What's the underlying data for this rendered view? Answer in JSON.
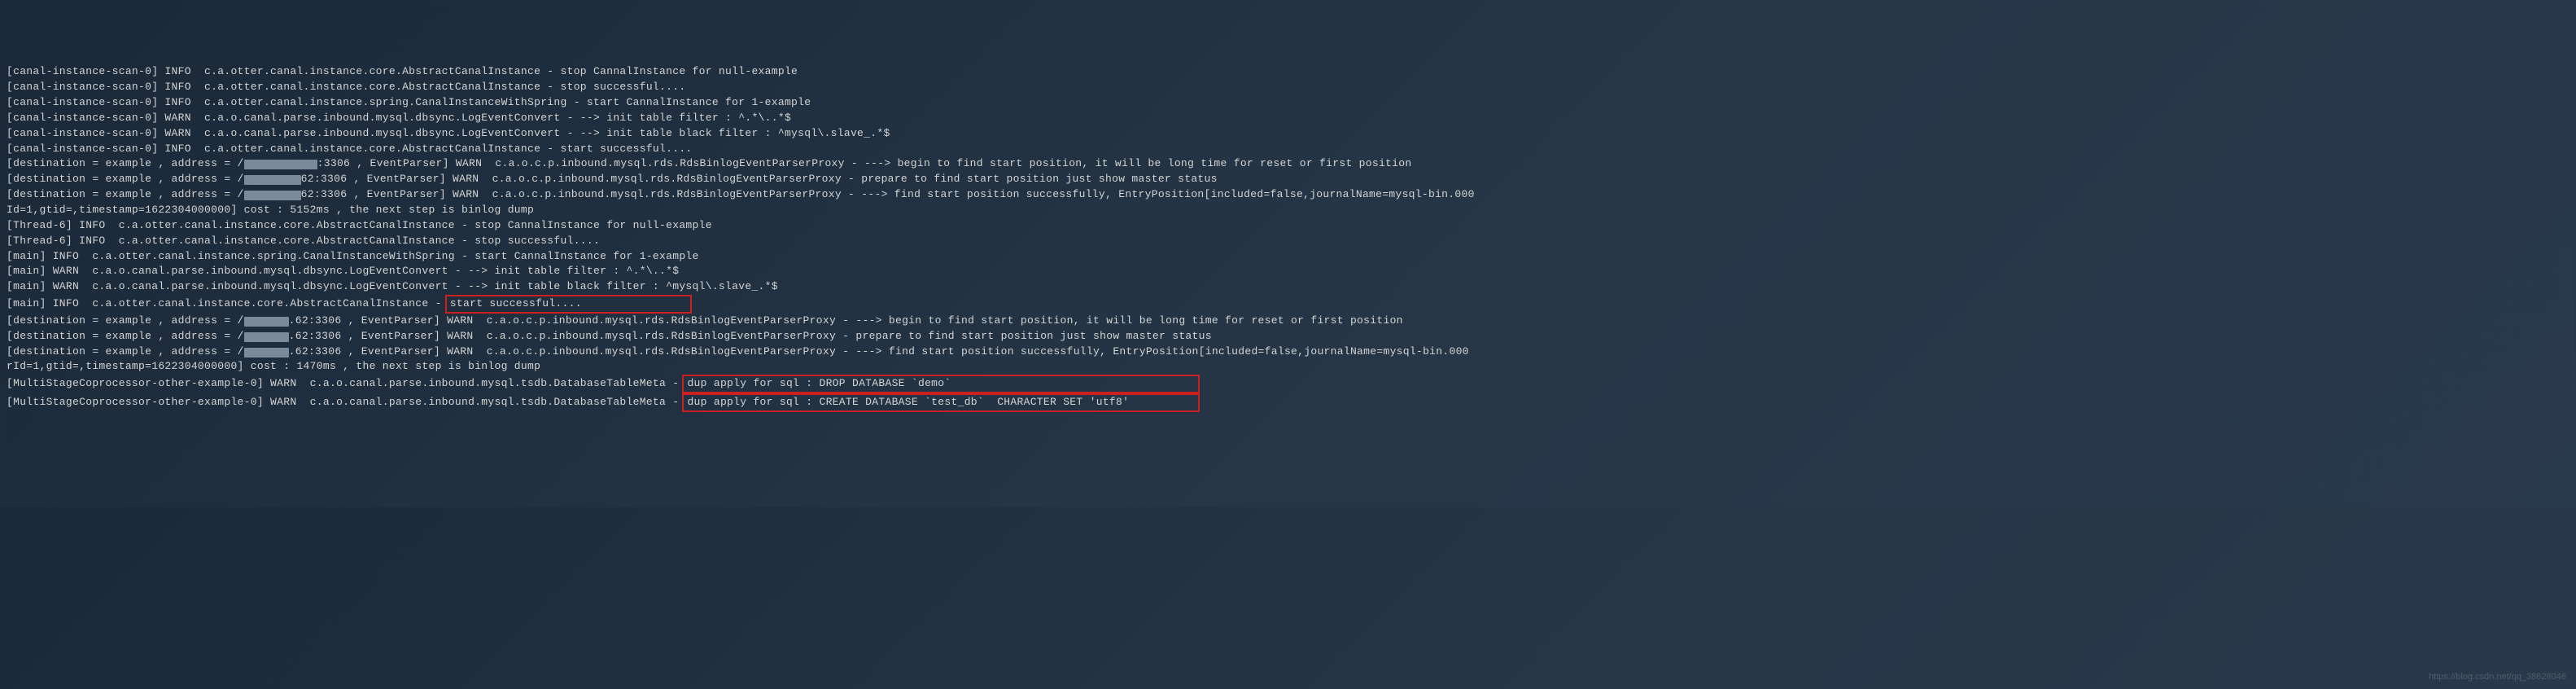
{
  "lines": [
    {
      "text": "[canal-instance-scan-0] INFO  c.a.otter.canal.instance.core.AbstractCanalInstance - stop CannalInstance for null-example "
    },
    {
      "text": "[canal-instance-scan-0] INFO  c.a.otter.canal.instance.core.AbstractCanalInstance - stop successful...."
    },
    {
      "text": "[canal-instance-scan-0] INFO  c.a.otter.canal.instance.spring.CanalInstanceWithSpring - start CannalInstance for 1-example "
    },
    {
      "text": "[canal-instance-scan-0] WARN  c.a.o.canal.parse.inbound.mysql.dbsync.LogEventConvert - --> init table filter : ^.*\\..*$"
    },
    {
      "text": "[canal-instance-scan-0] WARN  c.a.o.canal.parse.inbound.mysql.dbsync.LogEventConvert - --> init table black filter : ^mysql\\.slave_.*$"
    },
    {
      "text": "[canal-instance-scan-0] INFO  c.a.otter.canal.instance.core.AbstractCanalInstance - start successful...."
    },
    {
      "segments": [
        {
          "text": "[destination = example , address = /"
        },
        {
          "redact": 90
        },
        {
          "text": ":3306 , EventParser] WARN  c.a.o.c.p.inbound.mysql.rds.RdsBinlogEventParserProxy - ---> begin to find start position, it will be long time for reset or first position"
        }
      ]
    },
    {
      "segments": [
        {
          "text": "[destination = example , address = /"
        },
        {
          "redact": 70
        },
        {
          "text": "62:3306 , EventParser] WARN  c.a.o.c.p.inbound.mysql.rds.RdsBinlogEventParserProxy - prepare to find start position just show master status"
        }
      ]
    },
    {
      "segments": [
        {
          "text": "[destination = example , address = /"
        },
        {
          "redact": 70
        },
        {
          "text": "62:3306 , EventParser] WARN  c.a.o.c.p.inbound.mysql.rds.RdsBinlogEventParserProxy - ---> find start position successfully, EntryPosition[included=false,journalName=mysql-bin.000"
        }
      ]
    },
    {
      "text": "Id=1,gtid=,timestamp=1622304000000] cost : 5152ms , the next step is binlog dump"
    },
    {
      "text": "[Thread-6] INFO  c.a.otter.canal.instance.core.AbstractCanalInstance - stop CannalInstance for null-example "
    },
    {
      "text": "[Thread-6] INFO  c.a.otter.canal.instance.core.AbstractCanalInstance - stop successful...."
    },
    {
      "text": "[main] INFO  c.a.otter.canal.instance.spring.CanalInstanceWithSpring - start CannalInstance for 1-example "
    },
    {
      "text": "[main] WARN  c.a.o.canal.parse.inbound.mysql.dbsync.LogEventConvert - --> init table filter : ^.*\\..*$"
    },
    {
      "text": "[main] WARN  c.a.o.canal.parse.inbound.mysql.dbsync.LogEventConvert - --> init table black filter : ^mysql\\.slave_.*$"
    },
    {
      "segments": [
        {
          "text": "[main] INFO  c.a.otter.canal.instance.core.AbstractCanalInstance - "
        },
        {
          "box": "start successful....                "
        }
      ]
    },
    {
      "segments": [
        {
          "text": "[destination = example , address = /"
        },
        {
          "redact": 55
        },
        {
          "text": ".62:3306 , EventParser] WARN  c.a.o.c.p.inbound.mysql.rds.RdsBinlogEventParserProxy - ---> begin to find start position, it will be long time for reset or first position"
        }
      ]
    },
    {
      "segments": [
        {
          "text": "[destination = example , address = /"
        },
        {
          "redact": 55
        },
        {
          "text": ".62:3306 , EventParser] WARN  c.a.o.c.p.inbound.mysql.rds.RdsBinlogEventParserProxy - prepare to find start position just show master status"
        }
      ]
    },
    {
      "segments": [
        {
          "text": "[destination = example , address = /"
        },
        {
          "redact": 55
        },
        {
          "text": ".62:3306 , EventParser] WARN  c.a.o.c.p.inbound.mysql.rds.RdsBinlogEventParserProxy - ---> find start position successfully, EntryPosition[included=false,journalName=mysql-bin.000"
        }
      ]
    },
    {
      "text": "rId=1,gtid=,timestamp=1622304000000] cost : 1470ms , the next step is binlog dump"
    },
    {
      "segments": [
        {
          "text": "[MultiStageCoprocessor-other-example-0] WARN  c.a.o.canal.parse.inbound.mysql.tsdb.DatabaseTableMeta - "
        },
        {
          "box": "dup apply for sql : DROP DATABASE `demo`                                     "
        }
      ]
    },
    {
      "segments": [
        {
          "text": "[MultiStageCoprocessor-other-example-0] WARN  c.a.o.canal.parse.inbound.mysql.tsdb.DatabaseTableMeta - "
        },
        {
          "box": "dup apply for sql : CREATE DATABASE `test_db`  CHARACTER SET 'utf8'          "
        }
      ]
    }
  ],
  "watermark": "https://blog.csdn.net/qq_38628046"
}
